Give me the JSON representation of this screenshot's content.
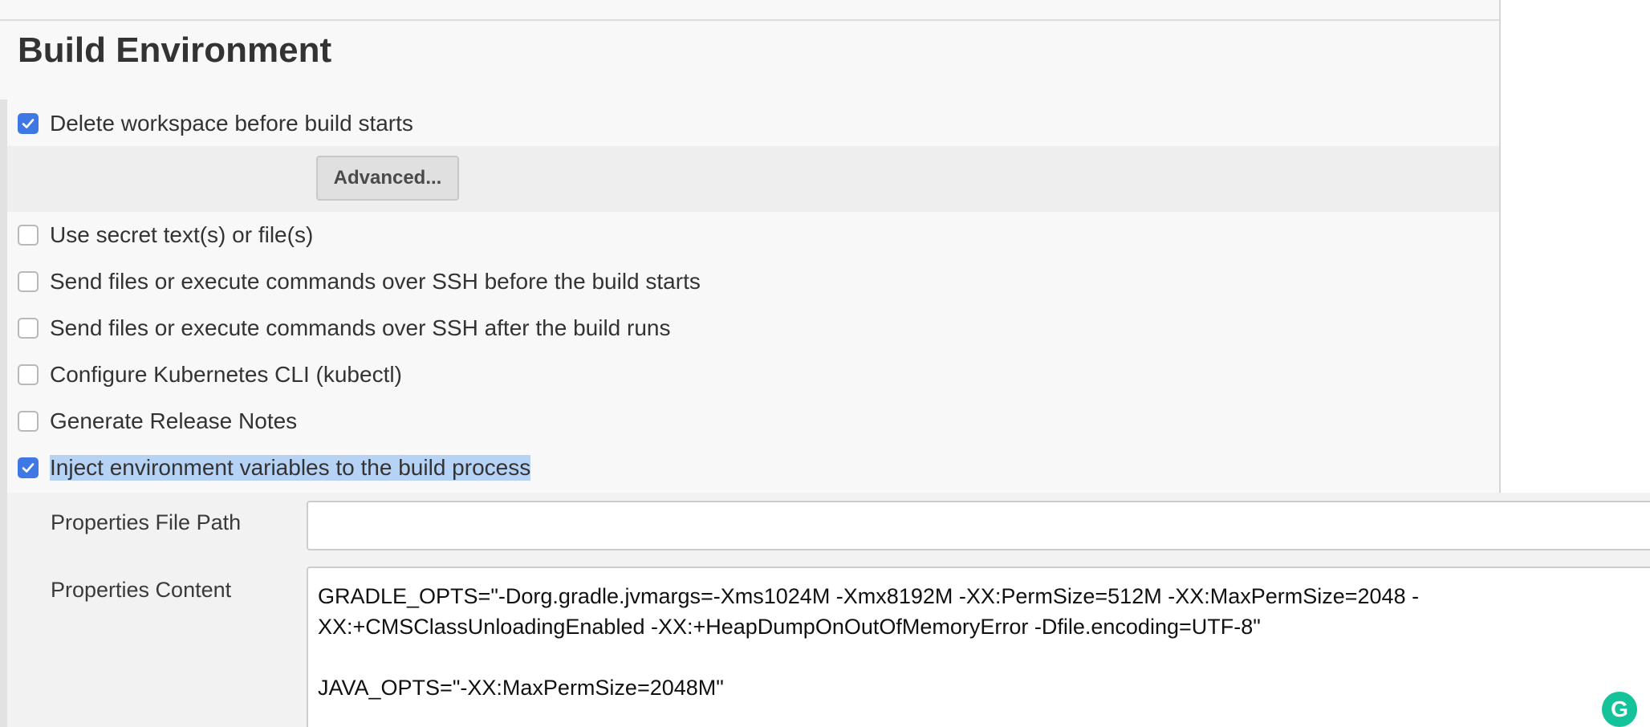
{
  "section": {
    "title": "Build Environment"
  },
  "options": [
    {
      "label": "Delete workspace before build starts",
      "checked": true
    },
    {
      "label": "Use secret text(s) or file(s)",
      "checked": false
    },
    {
      "label": "Send files or execute commands over SSH before the build starts",
      "checked": false
    },
    {
      "label": "Send files or execute commands over SSH after the build runs",
      "checked": false
    },
    {
      "label": "Configure Kubernetes CLI (kubectl)",
      "checked": false
    },
    {
      "label": "Generate Release Notes",
      "checked": false
    },
    {
      "label": "Inject environment variables to the build process",
      "checked": true
    }
  ],
  "advanced": {
    "label": "Advanced..."
  },
  "inject": {
    "properties_file_path_label": "Properties File Path",
    "properties_file_path_value": "",
    "properties_content_label": "Properties Content",
    "properties_content_value": "GRADLE_OPTS=\"-Dorg.gradle.jvmargs=-Xms1024M -Xmx8192M -XX:PermSize=512M -XX:MaxPermSize=2048 -\nXX:+CMSClassUnloadingEnabled -XX:+HeapDumpOnOutOfMemoryError -Dfile.encoding=UTF-8\"\n\nJAVA_OPTS=\"-XX:MaxPermSize=2048M\""
  },
  "grammarly": {
    "glyph": "G"
  },
  "colors": {
    "checkbox_checked": "#3f78e5",
    "selection_highlight": "#b6d3f6",
    "grammarly": "#15c39a"
  }
}
